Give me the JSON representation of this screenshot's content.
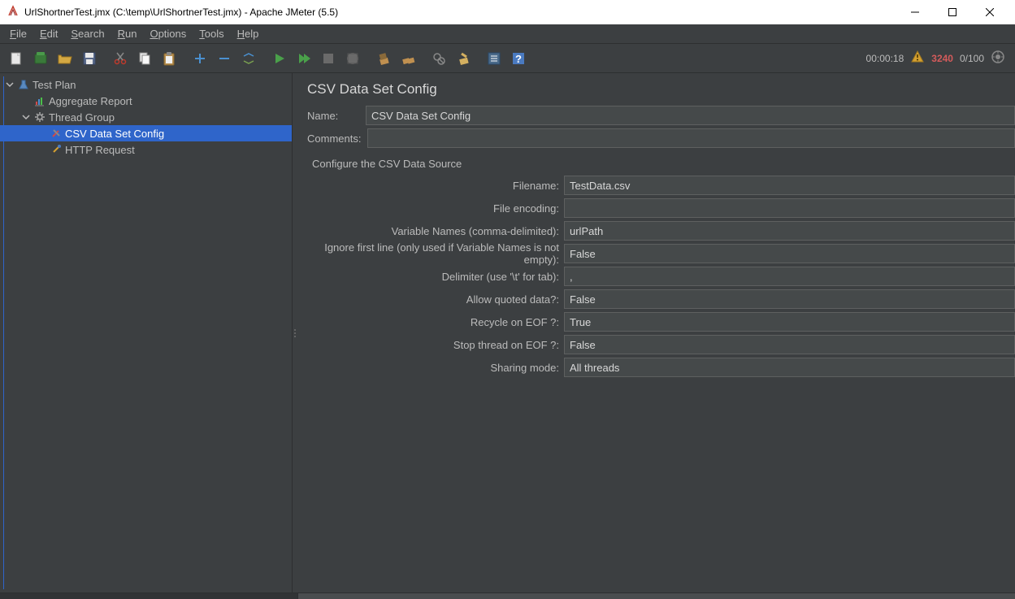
{
  "window": {
    "title": "UrlShortnerTest.jmx (C:\\temp\\UrlShortnerTest.jmx) - Apache JMeter (5.5)"
  },
  "menu": {
    "file": "File",
    "edit": "Edit",
    "search": "Search",
    "run": "Run",
    "options": "Options",
    "tools": "Tools",
    "help": "Help"
  },
  "toolbar": {
    "new_icon": "new",
    "templates_icon": "templates",
    "open_icon": "open",
    "save_icon": "save",
    "cut_icon": "cut",
    "copy_icon": "copy",
    "paste_icon": "paste",
    "expand_icon": "plus",
    "collapse_icon": "minus",
    "toggle_icon": "toggle",
    "start_icon": "start",
    "start_no_timers_icon": "start-no-pause",
    "stop_icon": "stop",
    "shutdown_icon": "shutdown",
    "clear_icon": "clear",
    "clear_all_icon": "clear-all",
    "search_icon": "search",
    "reset_search_icon": "reset-search",
    "fn_icon": "function-helper",
    "help_icon": "help"
  },
  "status": {
    "timer": "00:00:18",
    "errors": "3240",
    "threads": "0/100"
  },
  "tree": {
    "test_plan": "Test Plan",
    "aggregate_report": "Aggregate Report",
    "thread_group": "Thread Group",
    "csv_config": "CSV Data Set Config",
    "http_request": "HTTP Request"
  },
  "panel": {
    "title": "CSV Data Set Config",
    "name_label": "Name:",
    "name_value": "CSV Data Set Config",
    "comments_label": "Comments:",
    "comments_value": "",
    "section": "Configure the CSV Data Source",
    "fields": {
      "filename_label": "Filename:",
      "filename_value": "TestData.csv",
      "encoding_label": "File encoding:",
      "encoding_value": "",
      "varnames_label": "Variable Names (comma-delimited):",
      "varnames_value": "urlPath",
      "ignore_label": "Ignore first line (only used if Variable Names is not empty):",
      "ignore_value": "False",
      "delimiter_label": "Delimiter (use '\\t' for tab):",
      "delimiter_value": ",",
      "quoted_label": "Allow quoted data?:",
      "quoted_value": "False",
      "recycle_label": "Recycle on EOF ?:",
      "recycle_value": "True",
      "stop_label": "Stop thread on EOF ?:",
      "stop_value": "False",
      "sharing_label": "Sharing mode:",
      "sharing_value": "All threads"
    }
  }
}
